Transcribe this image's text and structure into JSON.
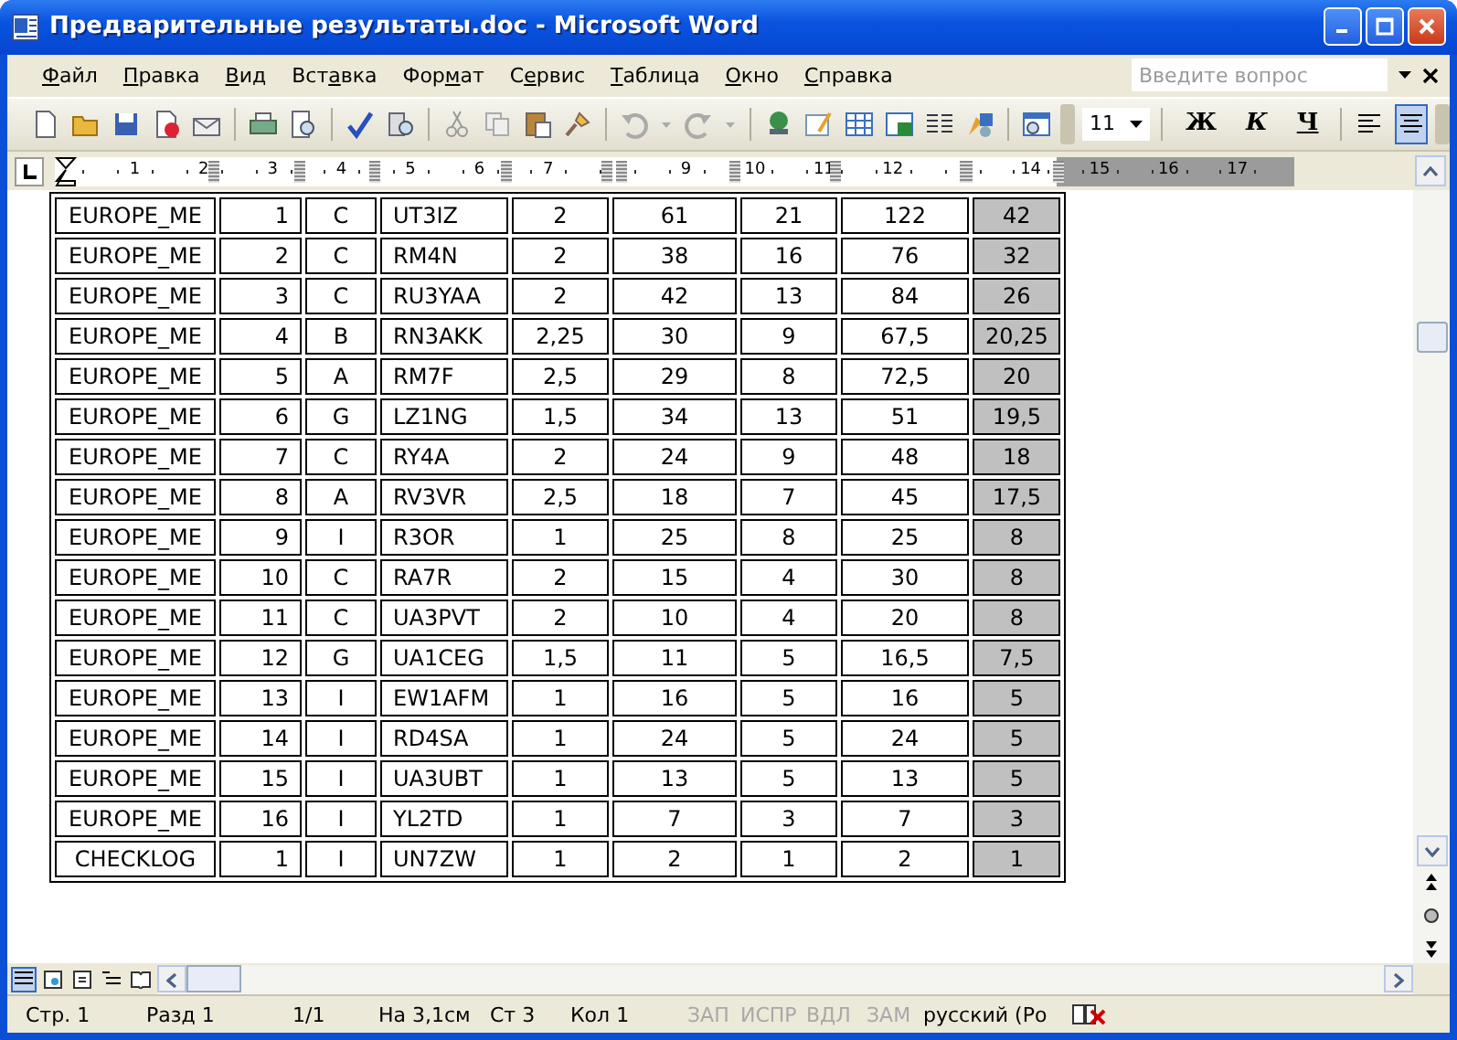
{
  "window": {
    "title": "Предварительные результаты.doc - Microsoft Word"
  },
  "menu": [
    {
      "key": "Ф",
      "post": "айл"
    },
    {
      "key": "П",
      "post": "равка"
    },
    {
      "key": "В",
      "post": "ид"
    },
    {
      "pre": "Вст",
      "key": "а",
      "post": "вка"
    },
    {
      "pre": "Фор",
      "key": "м",
      "post": "ат"
    },
    {
      "pre": "С",
      "key": "е",
      "post": "рвис"
    },
    {
      "key": "Т",
      "post": "аблица"
    },
    {
      "key": "О",
      "post": "кно"
    },
    {
      "key": "С",
      "post": "правка"
    }
  ],
  "help_box": {
    "placeholder": "Введите вопрос"
  },
  "toolbar": {
    "font_size": "11",
    "format_buttons": [
      {
        "kind": "bold",
        "label": "Ж"
      },
      {
        "kind": "italic",
        "label": "К"
      },
      {
        "kind": "underline",
        "label": "Ч"
      }
    ],
    "align_buttons": [
      {
        "kind": "left",
        "selected": false
      },
      {
        "kind": "center",
        "selected": true
      }
    ]
  },
  "ruler": {
    "slots": [
      {
        "kind": "number",
        "label": "1"
      },
      {
        "kind": "number",
        "label": "2"
      },
      {
        "kind": "number",
        "label": "3"
      },
      {
        "kind": "number",
        "label": "4"
      },
      {
        "kind": "number",
        "label": "5"
      },
      {
        "kind": "number",
        "label": "6"
      },
      {
        "kind": "number",
        "label": "7"
      },
      {
        "kind": "marker"
      },
      {
        "kind": "number",
        "label": "9"
      },
      {
        "kind": "number",
        "label": "10"
      },
      {
        "kind": "number",
        "label": "11"
      },
      {
        "kind": "number",
        "label": "12"
      },
      {
        "kind": "marker"
      },
      {
        "kind": "number",
        "label": "14"
      },
      {
        "kind": "number",
        "label": "15"
      },
      {
        "kind": "number",
        "label": "16"
      },
      {
        "kind": "number",
        "label": "17"
      }
    ]
  },
  "table": {
    "rows": [
      [
        "EUROPE_ME",
        "1",
        "C",
        "UT3IZ",
        "2",
        "61",
        "21",
        "122",
        "42"
      ],
      [
        "EUROPE_ME",
        "2",
        "C",
        "RM4N",
        "2",
        "38",
        "16",
        "76",
        "32"
      ],
      [
        "EUROPE_ME",
        "3",
        "C",
        "RU3YAA",
        "2",
        "42",
        "13",
        "84",
        "26"
      ],
      [
        "EUROPE_ME",
        "4",
        "B",
        "RN3AKK",
        "2,25",
        "30",
        "9",
        "67,5",
        "20,25"
      ],
      [
        "EUROPE_ME",
        "5",
        "A",
        "RM7F",
        "2,5",
        "29",
        "8",
        "72,5",
        "20"
      ],
      [
        "EUROPE_ME",
        "6",
        "G",
        "LZ1NG",
        "1,5",
        "34",
        "13",
        "51",
        "19,5"
      ],
      [
        "EUROPE_ME",
        "7",
        "C",
        "RY4A",
        "2",
        "24",
        "9",
        "48",
        "18"
      ],
      [
        "EUROPE_ME",
        "8",
        "A",
        "RV3VR",
        "2,5",
        "18",
        "7",
        "45",
        "17,5"
      ],
      [
        "EUROPE_ME",
        "9",
        "I",
        "R3OR",
        "1",
        "25",
        "8",
        "25",
        "8"
      ],
      [
        "EUROPE_ME",
        "10",
        "C",
        "RA7R",
        "2",
        "15",
        "4",
        "30",
        "8"
      ],
      [
        "EUROPE_ME",
        "11",
        "C",
        "UA3PVT",
        "2",
        "10",
        "4",
        "20",
        "8"
      ],
      [
        "EUROPE_ME",
        "12",
        "G",
        "UA1CEG",
        "1,5",
        "11",
        "5",
        "16,5",
        "7,5"
      ],
      [
        "EUROPE_ME",
        "13",
        "I",
        "EW1AFM",
        "1",
        "16",
        "5",
        "16",
        "5"
      ],
      [
        "EUROPE_ME",
        "14",
        "I",
        "RD4SA",
        "1",
        "24",
        "5",
        "24",
        "5"
      ],
      [
        "EUROPE_ME",
        "15",
        "I",
        "UA3UBT",
        "1",
        "13",
        "5",
        "13",
        "5"
      ],
      [
        "EUROPE_ME",
        "16",
        "I",
        "YL2TD",
        "1",
        "7",
        "3",
        "7",
        "3"
      ],
      [
        "CHECKLOG",
        "1",
        "I",
        "UN7ZW",
        "1",
        "2",
        "1",
        "2",
        "1"
      ]
    ]
  },
  "status_bar": [
    {
      "text": "Стр. 1",
      "disabled": false
    },
    {
      "text": "Разд 1",
      "disabled": false
    },
    {
      "text": "1/1",
      "disabled": false
    },
    {
      "text": "На 3,1см",
      "disabled": false
    },
    {
      "text": "Ст 3",
      "disabled": false
    },
    {
      "text": "Кол 1",
      "disabled": false
    },
    {
      "text": "ЗАП",
      "disabled": true
    },
    {
      "text": "ИСПР",
      "disabled": true
    },
    {
      "text": "ВДЛ",
      "disabled": true
    },
    {
      "text": "ЗАМ",
      "disabled": true
    },
    {
      "text": "русский (Ро",
      "disabled": false
    }
  ]
}
